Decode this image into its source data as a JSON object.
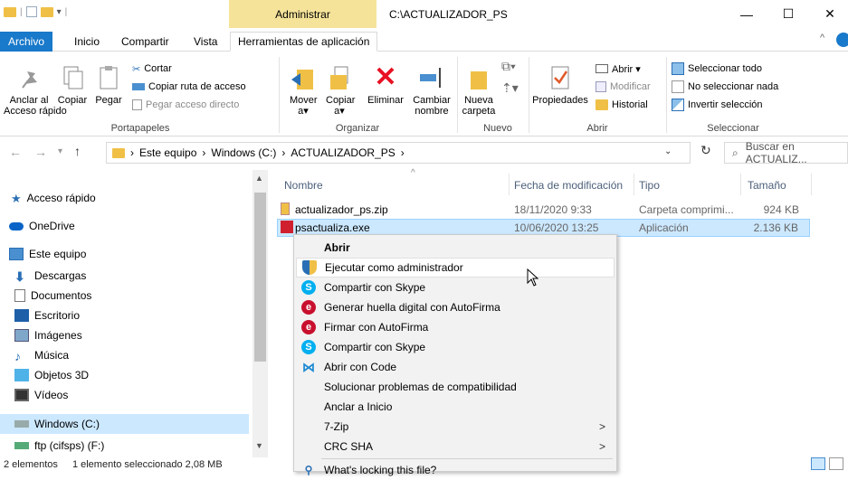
{
  "titlebar": {
    "manage_tab": "Administrar",
    "path_title": "C:\\ACTUALIZADOR_PS",
    "minimize": "—",
    "maximize": "☐",
    "close": "✕"
  },
  "tabs": [
    "Archivo",
    "Inicio",
    "Compartir",
    "Vista",
    "Herramientas de aplicación"
  ],
  "ribbon": {
    "pin": "Anclar al\nAcceso rápido",
    "copy": "Copiar",
    "paste": "Pegar",
    "cut": "Cortar",
    "copy_path": "Copiar ruta de acceso",
    "paste_shortcut": "Pegar acceso directo",
    "group_clipboard": "Portapapeles",
    "move_to": "Mover a▾",
    "copy_to": "Copiar a▾",
    "delete": "Eliminar",
    "rename": "Cambiar nombre",
    "group_organize": "Organizar",
    "new_folder": "Nueva carpeta",
    "group_new": "Nuevo",
    "properties": "Propiedades",
    "open": "Abrir ▾",
    "edit": "Modificar",
    "history": "Historial",
    "group_open": "Abrir",
    "select_all": "Seleccionar todo",
    "select_none": "No seleccionar nada",
    "invert_selection": "Invertir selección",
    "group_select": "Seleccionar"
  },
  "address": {
    "crumb_pc": "Este equipo",
    "crumb_drive": "Windows (C:)",
    "crumb_folder": "ACTUALIZADOR_PS",
    "search_placeholder": "Buscar en ACTUALIZ..."
  },
  "nav": [
    {
      "label": "Acceso rápido",
      "icon": "star-icon"
    },
    {
      "label": "OneDrive",
      "icon": "cloud-icon"
    },
    {
      "label": "Este equipo",
      "icon": "computer-icon"
    },
    {
      "label": "Descargas",
      "icon": "download-icon"
    },
    {
      "label": "Documentos",
      "icon": "document-icon"
    },
    {
      "label": "Escritorio",
      "icon": "desktop-icon"
    },
    {
      "label": "Imágenes",
      "icon": "pictures-icon"
    },
    {
      "label": "Música",
      "icon": "music-icon"
    },
    {
      "label": "Objetos 3D",
      "icon": "cube-icon"
    },
    {
      "label": "Vídeos",
      "icon": "video-icon"
    },
    {
      "label": "Windows (C:)",
      "icon": "drive-icon"
    },
    {
      "label": "ftp (cifsps) (F:)",
      "icon": "network-drive-icon"
    }
  ],
  "columns": {
    "name": "Nombre",
    "date": "Fecha de modificación",
    "type": "Tipo",
    "size": "Tamaño"
  },
  "files": [
    {
      "name": "actualizador_ps.zip",
      "date": "18/11/2020 9:33",
      "type": "Carpeta comprimi...",
      "size": "924 KB"
    },
    {
      "name": "psactualiza.exe",
      "date": "10/06/2020 13:25",
      "type": "Aplicación",
      "size": "2.136 KB"
    }
  ],
  "status": {
    "count": "2 elementos",
    "selection": "1 elemento seleccionado  2,08 MB"
  },
  "context_menu": [
    {
      "label": "Abrir",
      "bold": true,
      "icon": ""
    },
    {
      "label": "Ejecutar como administrador",
      "icon": "shield-icon"
    },
    {
      "label": "Compartir con Skype",
      "icon": "skype-icon"
    },
    {
      "label": "Generar huella digital con AutoFirma",
      "icon": "autofirma-icon"
    },
    {
      "label": "Firmar con AutoFirma",
      "icon": "autofirma-icon"
    },
    {
      "label": "Compartir con Skype",
      "icon": "skype-icon"
    },
    {
      "label": "Abrir con Code",
      "icon": "vscode-icon"
    },
    {
      "label": "Solucionar problemas de compatibilidad",
      "icon": ""
    },
    {
      "label": "Anclar a Inicio",
      "icon": ""
    },
    {
      "label": "7-Zip",
      "icon": "",
      "submenu": true
    },
    {
      "label": "CRC SHA",
      "icon": "",
      "submenu": true
    },
    {
      "label": "What's locking this file?",
      "icon": "lock-search-icon"
    }
  ],
  "colors": {
    "accent": "#1979ca",
    "selection": "#cce8ff",
    "manage": "#f5e39a",
    "folder": "#f0c046"
  }
}
